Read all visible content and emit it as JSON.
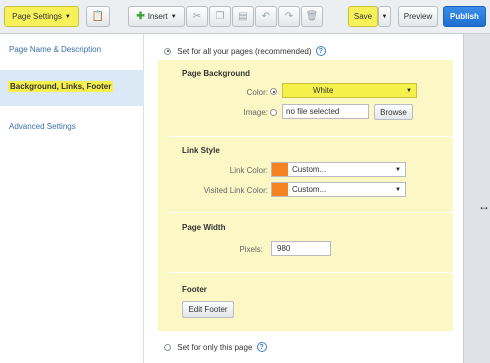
{
  "toolbar": {
    "page_settings_label": "Page Settings",
    "insert_label": "Insert",
    "save_label": "Save",
    "preview_label": "Preview",
    "publish_label": "Publish"
  },
  "sidebar": {
    "items": [
      {
        "label": "Page Name & Description"
      },
      {
        "label": "Background, Links, Footer"
      },
      {
        "label": "Advanced Settings"
      }
    ]
  },
  "options": {
    "all_pages_label": "Set for all your pages (recommended)",
    "only_page_label": "Set for only this page"
  },
  "background": {
    "title": "Page Background",
    "color_label": "Color:",
    "color_value": "White",
    "image_label": "Image:",
    "file_text": "no file selected",
    "browse_label": "Browse"
  },
  "links": {
    "title": "Link Style",
    "link_color_label": "Link Color:",
    "link_color_value": "Custom...",
    "visited_label": "Visited Link Color:",
    "visited_value": "Custom...",
    "swatch_color": "#f58220"
  },
  "width": {
    "title": "Page Width",
    "pixels_label": "Pixels:",
    "pixels_value": "980"
  },
  "footer": {
    "title": "Footer",
    "edit_label": "Edit Footer"
  }
}
